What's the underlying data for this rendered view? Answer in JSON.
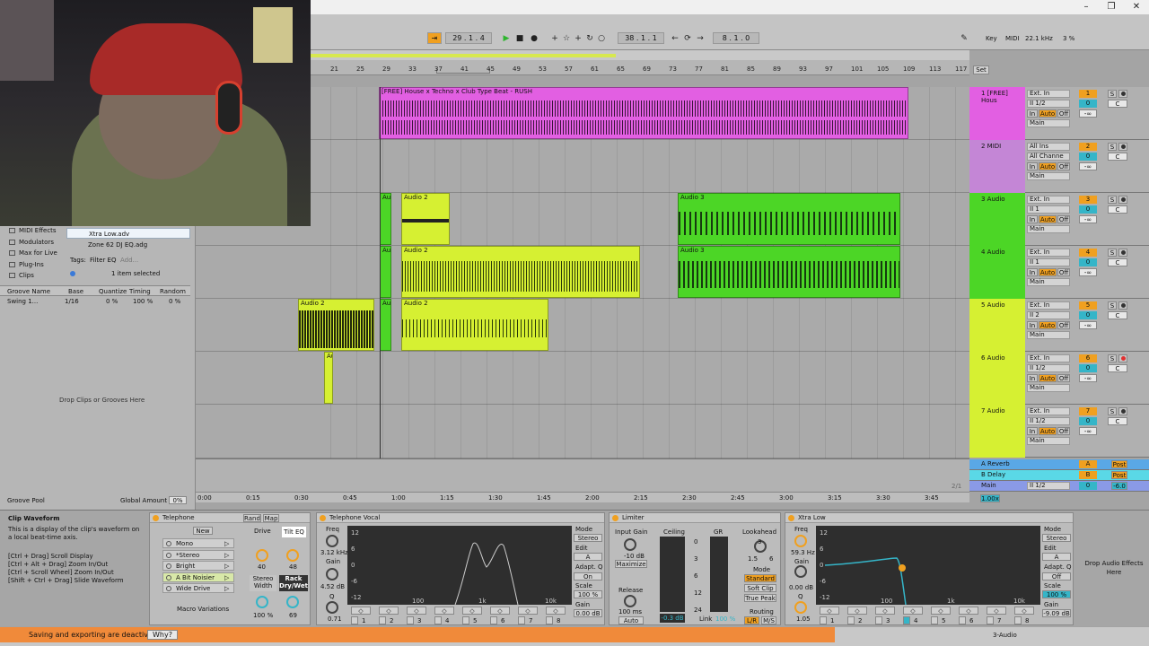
{
  "transport": {
    "position": "29 . 1 . 4",
    "loop_start": "38 . 1 . 1",
    "loop_length": "8 . 1 . 0",
    "key_label": "Key",
    "midi_label": "MIDI",
    "sample_rate": "22.1 kHz",
    "cpu": "3 %"
  },
  "ruler": {
    "bars": [
      "21",
      "25",
      "29",
      "33",
      "37",
      "41",
      "45",
      "49",
      "53",
      "57",
      "61",
      "65",
      "69",
      "73",
      "77",
      "81",
      "85",
      "89",
      "93",
      "97",
      "101",
      "105",
      "109",
      "113",
      "117"
    ],
    "set_label": "Set",
    "times": [
      "0:00",
      "0:15",
      "0:30",
      "0:45",
      "1:00",
      "1:15",
      "1:30",
      "1:45",
      "2:00",
      "2:15",
      "2:30",
      "2:45",
      "3:00",
      "3:15",
      "3:30",
      "3:45"
    ],
    "page_indicator": "2/1"
  },
  "clips": {
    "main_clip_title": "[FREE] House x Techno x Club Type Beat - RUSH",
    "audio2": "Audio 2",
    "audio3": "Audio 3",
    "audio5": "Audio 5",
    "au": "Au"
  },
  "tracks": [
    {
      "name": "1 [FREE] Hous",
      "input": "Ext. In",
      "channel": "II 1/2",
      "num": "1",
      "color": "#e25fe2"
    },
    {
      "name": "2 MIDI",
      "input": "All Ins",
      "channel": "All Channe",
      "num": "2",
      "color": "#c486d6"
    },
    {
      "name": "3 Audio",
      "input": "Ext. In",
      "channel": "II 1",
      "num": "3",
      "color": "#4cd626"
    },
    {
      "name": "4 Audio",
      "input": "Ext. In",
      "channel": "II 1",
      "num": "4",
      "color": "#4cd626"
    },
    {
      "name": "5 Audio",
      "input": "Ext. In",
      "channel": "II 2",
      "num": "5",
      "color": "#d6f032"
    },
    {
      "name": "6 Audio",
      "input": "Ext. In",
      "channel": "II 1/2",
      "num": "6",
      "color": "#d6f032"
    },
    {
      "name": "7 Audio",
      "input": "Ext. In",
      "channel": "II 1/2",
      "num": "7",
      "color": "#d6f032"
    }
  ],
  "track_labels": {
    "in": "In",
    "auto": "Auto",
    "off": "Off",
    "main": "Main",
    "s": "S",
    "c": "C",
    "neg_inf": "-∞",
    "zero": "0"
  },
  "returns": [
    {
      "name": "A Reverb",
      "letter": "A",
      "post": "Post"
    },
    {
      "name": "B Delay",
      "letter": "B",
      "post": "Post"
    },
    {
      "name": "Main",
      "channel": "II 1/2",
      "vol": "0",
      "peak": "-6.0",
      "tempo": "1.00x"
    }
  ],
  "browser": {
    "categories": [
      "MIDI Effects",
      "Modulators",
      "Max for Live",
      "Plug-Ins",
      "Clips"
    ],
    "files": [
      "Xtra Low.adv",
      "Zone 62 DJ EQ.adg"
    ],
    "tags_label": "Tags:",
    "tag": "Filter EQ",
    "add_label": "Add...",
    "selected_count": "1 item selected",
    "groove_headers": [
      "Groove Name",
      "Base",
      "Quantize",
      "Timing",
      "Random"
    ],
    "groove_row": [
      "Swing 1...",
      "1/16",
      "0 %",
      "100 %",
      "0 %"
    ],
    "drop_hint": "Drop Clips or Grooves Here",
    "groove_pool": "Groove Pool",
    "global_amount_label": "Global Amount",
    "global_amount": "0%"
  },
  "info": {
    "title": "Clip Waveform",
    "body": "This is a display of the clip's waveform on a local beat-time axis.",
    "hints": [
      "[Ctrl + Drag] Scroll Display",
      "[Ctrl + Alt + Drag] Zoom In/Out",
      "[Ctrl + Scroll Wheel] Zoom In/Out",
      "[Shift + Ctrl + Drag] Slide Waveform"
    ]
  },
  "telephone_rack": {
    "title": "Telephone",
    "rand": "Rand",
    "map": "Map",
    "new": "New",
    "chains": [
      "Mono",
      "*Stereo",
      "Bright",
      "A Bit Noisier",
      "Wide Drive"
    ],
    "macro_variations": "Macro Variations",
    "macros": [
      {
        "label": "Drive",
        "value": "40"
      },
      {
        "label": "Tilt EQ",
        "value": "48"
      },
      {
        "label": "Stereo Width",
        "value": "100 %"
      },
      {
        "label": "Rack Dry/Wet",
        "value": "69"
      }
    ]
  },
  "telephone_vocal": {
    "title": "Telephone Vocal",
    "freq_label": "Freq",
    "freq": "3.12 kHz",
    "gain_label": "Gain",
    "gain": "4.52 dB",
    "q_label": "Q",
    "q": "0.71",
    "axis_y": [
      "12",
      "6",
      "0",
      "-6",
      "-12"
    ],
    "axis_x": [
      "100",
      "1k",
      "10k"
    ],
    "mode_label": "Mode",
    "mode": "Stereo",
    "edit_label": "Edit",
    "edit": "A",
    "adapt_label": "Adapt. Q",
    "adapt": "On",
    "scale_label": "Scale",
    "scale": "100 %",
    "out_gain_label": "Gain",
    "out_gain": "0.00 dB",
    "bands": [
      "1",
      "2",
      "3",
      "4",
      "5",
      "6",
      "7",
      "8"
    ]
  },
  "limiter": {
    "title": "Limiter",
    "input_gain_label": "Input Gain",
    "input_gain": "-10 dB",
    "maximize": "Maximize",
    "release_label": "Release",
    "release": "100 ms",
    "auto": "Auto",
    "ceiling_label": "Ceiling",
    "gr_label": "GR",
    "scale": [
      "0",
      "3",
      "6",
      "12",
      "24"
    ],
    "ceiling": "-0.3 dB",
    "link_label": "Link",
    "link": "100 %",
    "lookahead_label": "Lookahead",
    "lookahead_vals": [
      "1.5",
      "3",
      "6"
    ],
    "mode_label": "Mode",
    "modes": [
      "Standard",
      "Soft Clip",
      "True Peak"
    ],
    "routing_label": "Routing",
    "routing": [
      "L/R",
      "M/S"
    ]
  },
  "xtra_low": {
    "title": "Xtra Low",
    "freq_label": "Freq",
    "freq": "59.3 Hz",
    "gain_label": "Gain",
    "gain": "0.00 dB",
    "q_label": "Q",
    "q": "1.05",
    "axis_y": [
      "12",
      "6",
      "0",
      "-6",
      "-12"
    ],
    "axis_x": [
      "100",
      "1k",
      "10k"
    ],
    "mode_label": "Mode",
    "mode": "Stereo",
    "edit_label": "Edit",
    "edit": "A",
    "adapt_label": "Adapt. Q",
    "adapt": "Off",
    "scale_label": "Scale",
    "scale": "100 %",
    "out_gain_label": "Gain",
    "out_gain": "-9.09 dB",
    "bands": [
      "1",
      "2",
      "3",
      "4",
      "5",
      "6",
      "7",
      "8"
    ]
  },
  "drop_effects": "Drop Audio Effects Here",
  "status": {
    "message": "Saving and exporting are deactivated.",
    "why": "Why?",
    "track": "3-Audio"
  },
  "colors": {
    "magenta": "#e25fe2",
    "green": "#4cd626",
    "yellow": "#d6f032",
    "orange": "#f0a020",
    "status_orange": "#f08a3a",
    "teal": "#35b5c8"
  }
}
